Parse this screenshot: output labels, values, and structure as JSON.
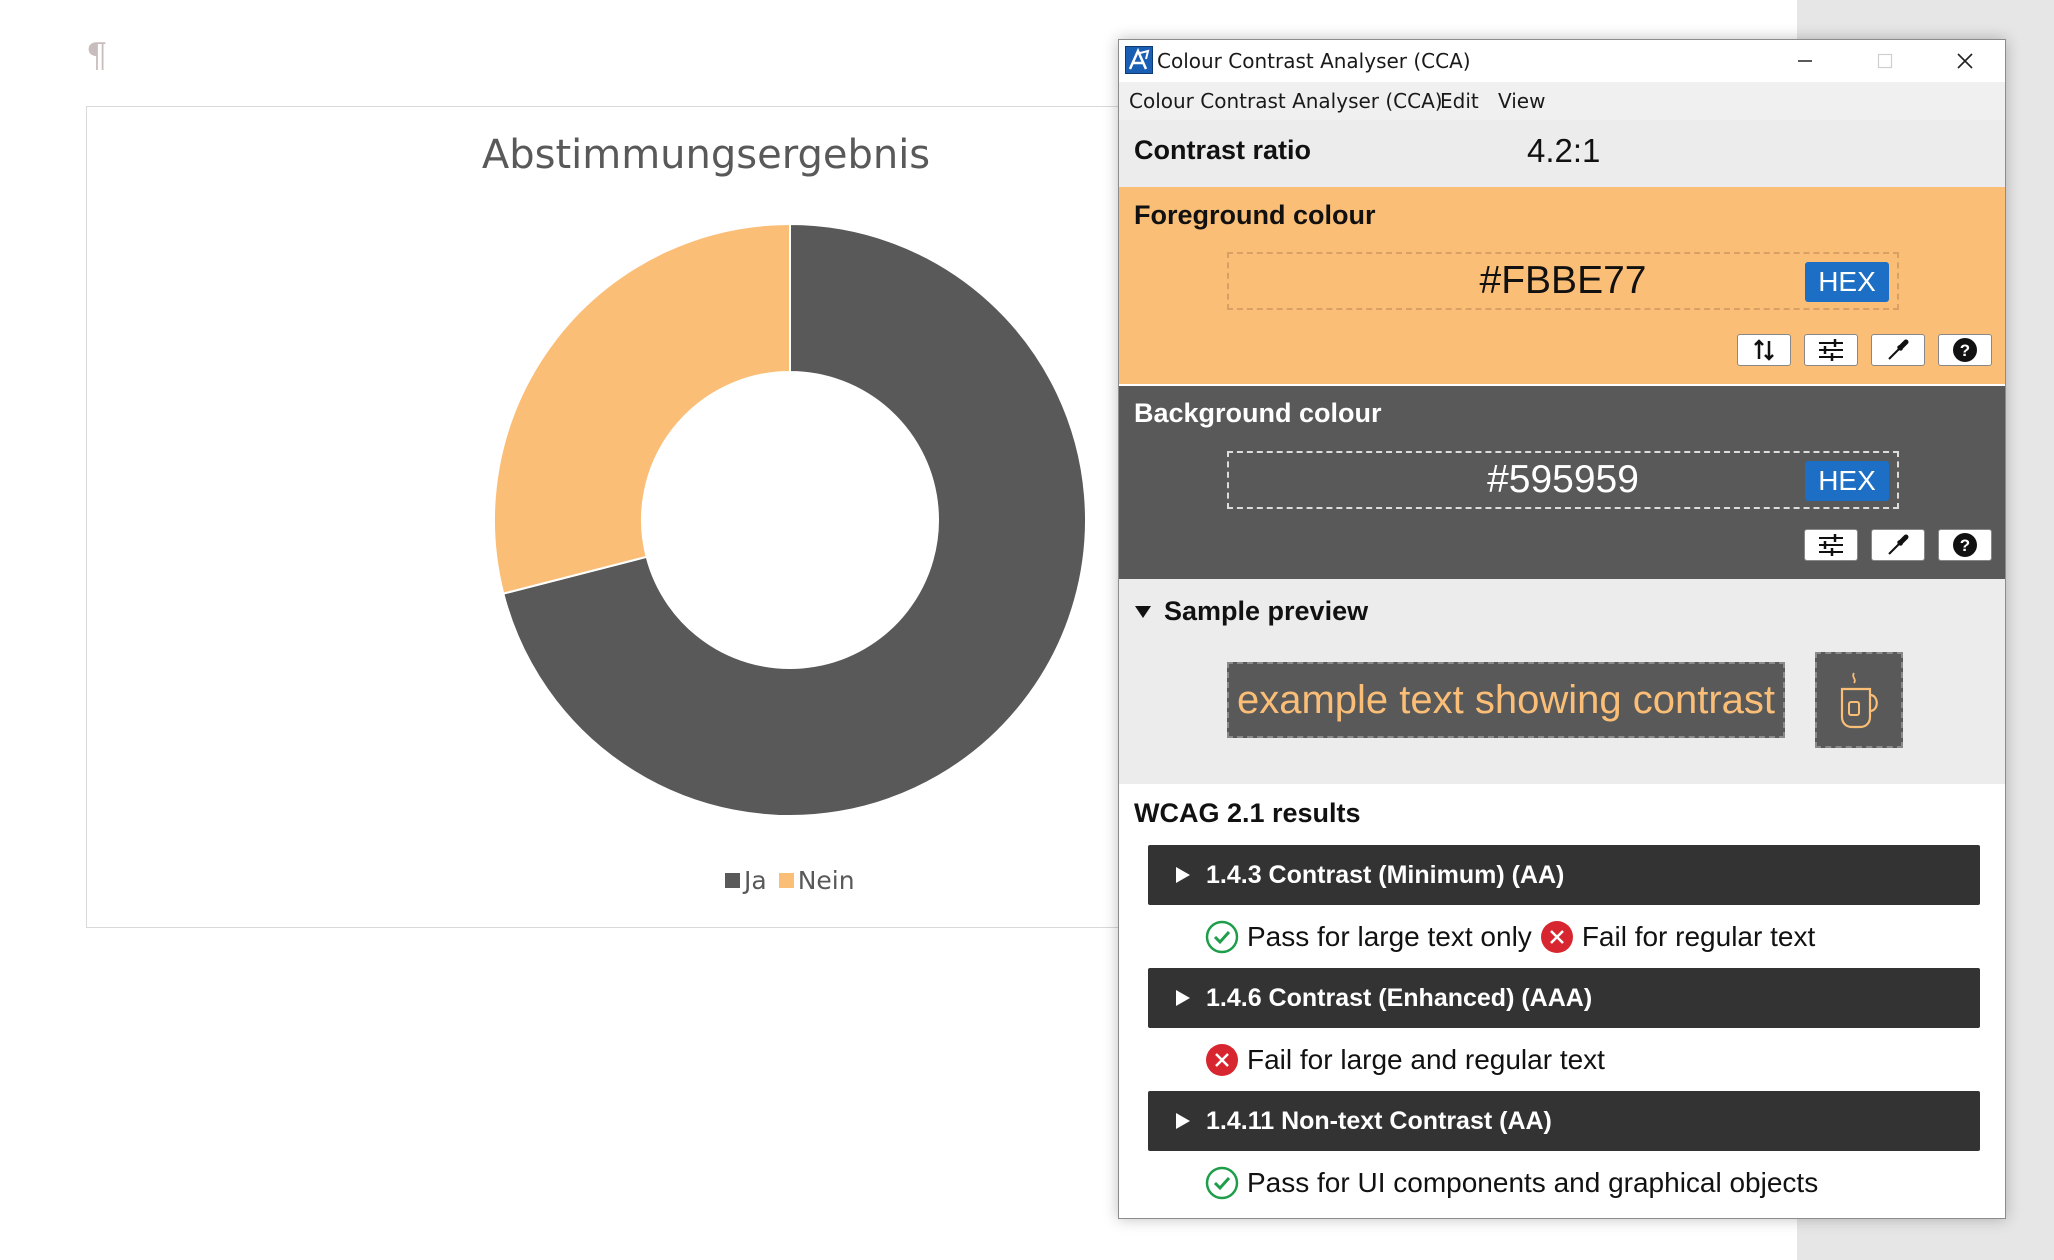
{
  "document": {
    "pilcrow": "¶"
  },
  "chart_data": {
    "type": "pie",
    "title": "Abstimmungsergebnis",
    "categories": [
      "Ja",
      "Nein"
    ],
    "values": [
      71,
      29
    ],
    "colors": [
      "#595959",
      "#fbbe77"
    ],
    "donut": true,
    "legend_position": "bottom"
  },
  "cca": {
    "title": "Colour Contrast Analyser (CCA)",
    "menu": [
      "Colour Contrast Analyser (CCA)",
      "Edit",
      "View"
    ],
    "ratio_label": "Contrast ratio",
    "ratio_value": "4.2:1",
    "foreground": {
      "label": "Foreground colour",
      "value": "#FBBE77",
      "format": "HEX",
      "color": "#fbbe77"
    },
    "background": {
      "label": "Background colour",
      "value": "#595959",
      "format": "HEX",
      "color": "#595959"
    },
    "preview": {
      "label": "Sample preview",
      "text": "example text showing contrast"
    },
    "wcag": {
      "label": "WCAG 2.1 results",
      "criteria": [
        {
          "title": "1.4.3 Contrast (Minimum) (AA)",
          "results": [
            {
              "status": "pass",
              "text": "Pass for large text only"
            },
            {
              "status": "fail",
              "text": "Fail for regular text"
            }
          ]
        },
        {
          "title": "1.4.6 Contrast (Enhanced) (AAA)",
          "results": [
            {
              "status": "fail",
              "text": "Fail for large and regular text"
            }
          ]
        },
        {
          "title": "1.4.11 Non-text Contrast (AA)",
          "results": [
            {
              "status": "pass",
              "text": "Pass for UI components and graphical objects"
            }
          ]
        }
      ]
    },
    "icons": {
      "app": "cca-app-icon",
      "minimize": "minimize-icon",
      "maximize": "maximize-icon",
      "close": "close-icon",
      "swap": "swap-colours-icon",
      "sliders": "sliders-icon",
      "eyedropper": "eyedropper-icon",
      "help": "help-icon",
      "mug": "mug-icon",
      "pass": "check-circle-icon",
      "fail": "x-circle-icon"
    },
    "status_colors": {
      "pass": "#1e9e4a",
      "fail": "#d7262f"
    }
  }
}
